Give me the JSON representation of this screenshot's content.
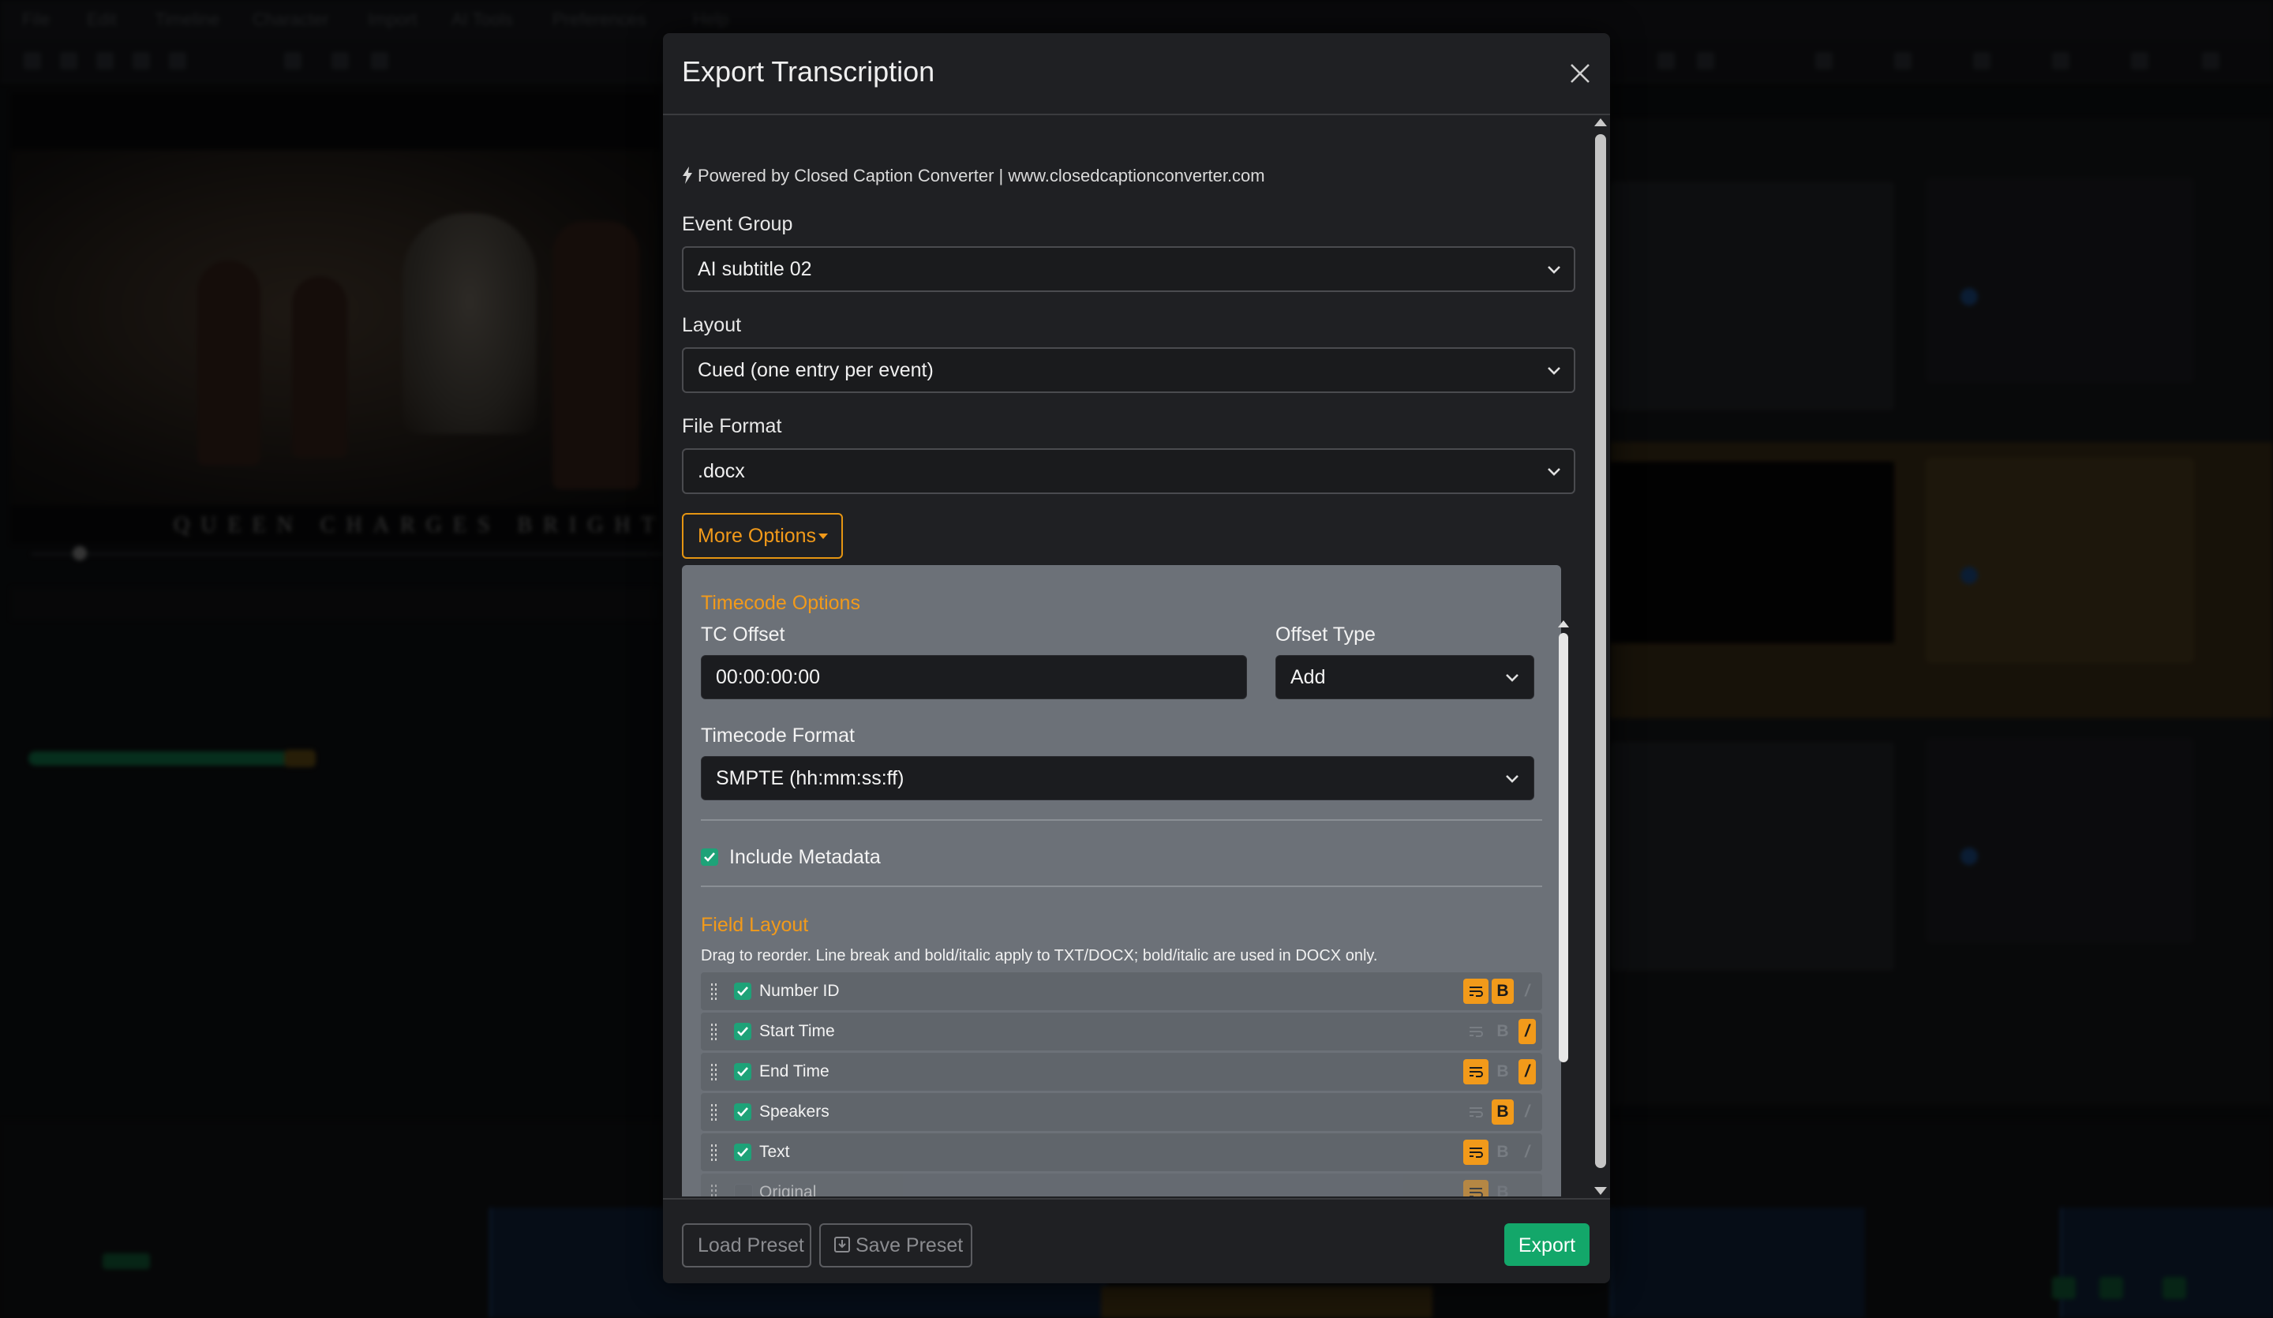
{
  "background": {
    "menu_items": [
      "File",
      "Edit",
      "Timeline",
      "Character",
      "Import",
      "AI Tools",
      "Preferences",
      "Help"
    ],
    "caption_text": "QUEEN CHARGES BRIGHTER"
  },
  "modal": {
    "title": "Export Transcription",
    "powered_by": "Powered by Closed Caption Converter | www.closedcaptionconverter.com",
    "event_group": {
      "label": "Event Group",
      "value": "AI subtitle 02"
    },
    "layout": {
      "label": "Layout",
      "value": "Cued (one entry per event)"
    },
    "file_format": {
      "label": "File Format",
      "value": ".docx"
    },
    "more_options_label": "More Options",
    "timecode_options": {
      "title": "Timecode Options",
      "tc_offset_label": "TC Offset",
      "tc_offset_value": "00:00:00:00",
      "offset_type_label": "Offset Type",
      "offset_type_value": "Add",
      "timecode_format_label": "Timecode Format",
      "timecode_format_value": "SMPTE (hh:mm:ss:ff)"
    },
    "include_metadata_label": "Include Metadata",
    "field_layout": {
      "title": "Field Layout",
      "hint": "Drag to reorder. Line break and bold/italic apply to TXT/DOCX; bold/italic are used in DOCX only.",
      "fields": [
        {
          "label": "Number ID",
          "checked": true,
          "linebreak": true,
          "bold": true,
          "italic": false
        },
        {
          "label": "Start Time",
          "checked": true,
          "linebreak": false,
          "bold": false,
          "italic": true
        },
        {
          "label": "End Time",
          "checked": true,
          "linebreak": true,
          "bold": false,
          "italic": true
        },
        {
          "label": "Speakers",
          "checked": true,
          "linebreak": false,
          "bold": true,
          "italic": false
        },
        {
          "label": "Text",
          "checked": true,
          "linebreak": true,
          "bold": false,
          "italic": false
        },
        {
          "label": "Original",
          "checked": false,
          "linebreak": true,
          "bold": false,
          "italic": false
        }
      ],
      "bold_glyph": "B",
      "italic_glyph": "/"
    },
    "footer": {
      "load_preset_label": "Load Preset",
      "save_preset_label": "Save Preset",
      "export_label": "Export"
    }
  },
  "colors": {
    "accent": "#f29a1a",
    "success": "#13a76a",
    "panel": "#6c7178"
  },
  "icons": [
    "bolt-icon",
    "close-icon",
    "chevron-down-icon",
    "checkmark-icon",
    "drag-handle-icon",
    "line-break-icon",
    "save-icon"
  ]
}
